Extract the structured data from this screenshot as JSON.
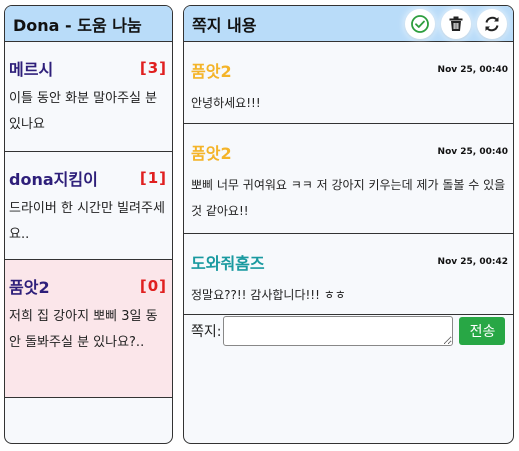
{
  "left_panel": {
    "title": "Dona - 도움 나눔",
    "threads": [
      {
        "name": "메르시",
        "count": "[3]",
        "preview": "이틀 동안 화분 말아주실 분 있나요",
        "selected": false
      },
      {
        "name": "dona지킴이",
        "count": "[1]",
        "preview": "드라이버 한 시간만 빌려주세요..",
        "selected": false
      },
      {
        "name": "품앗2",
        "count": "[0]",
        "preview": "저희 집 강아지 뽀삐 3일 동안 돌봐주실 분 있나요?..",
        "selected": true
      }
    ]
  },
  "right_panel": {
    "title": "쪽지 내용",
    "buttons": {
      "confirm": "check-circle-icon",
      "delete": "trash-icon",
      "refresh": "refresh-icon"
    },
    "messages": [
      {
        "sender": "품앗2",
        "sender_color": "#f4b429",
        "time": "Nov 25, 00:40",
        "text": "안녕하세요!!!"
      },
      {
        "sender": "품앗2",
        "sender_color": "#f4b429",
        "time": "Nov 25, 00:40",
        "text": "뽀삐 너무 귀여워요 ㅋㅋ 저 강아지 키우는데 제가 돌볼 수 있을 것 같아요!!"
      },
      {
        "sender": "도와줘홈즈",
        "sender_color": "#1a9aa0",
        "time": "Nov 25, 00:42",
        "text": "정말요??!! 감사합니다!!! ㅎㅎ"
      }
    ],
    "compose": {
      "label": "쪽지:",
      "value": "",
      "send_label": "전송"
    }
  },
  "colors": {
    "header_bg": "#b9dcf9",
    "selected_bg": "#fbe6ea",
    "count": "#e02020",
    "send": "#28a745",
    "thread_name": "#2e1f7a"
  }
}
